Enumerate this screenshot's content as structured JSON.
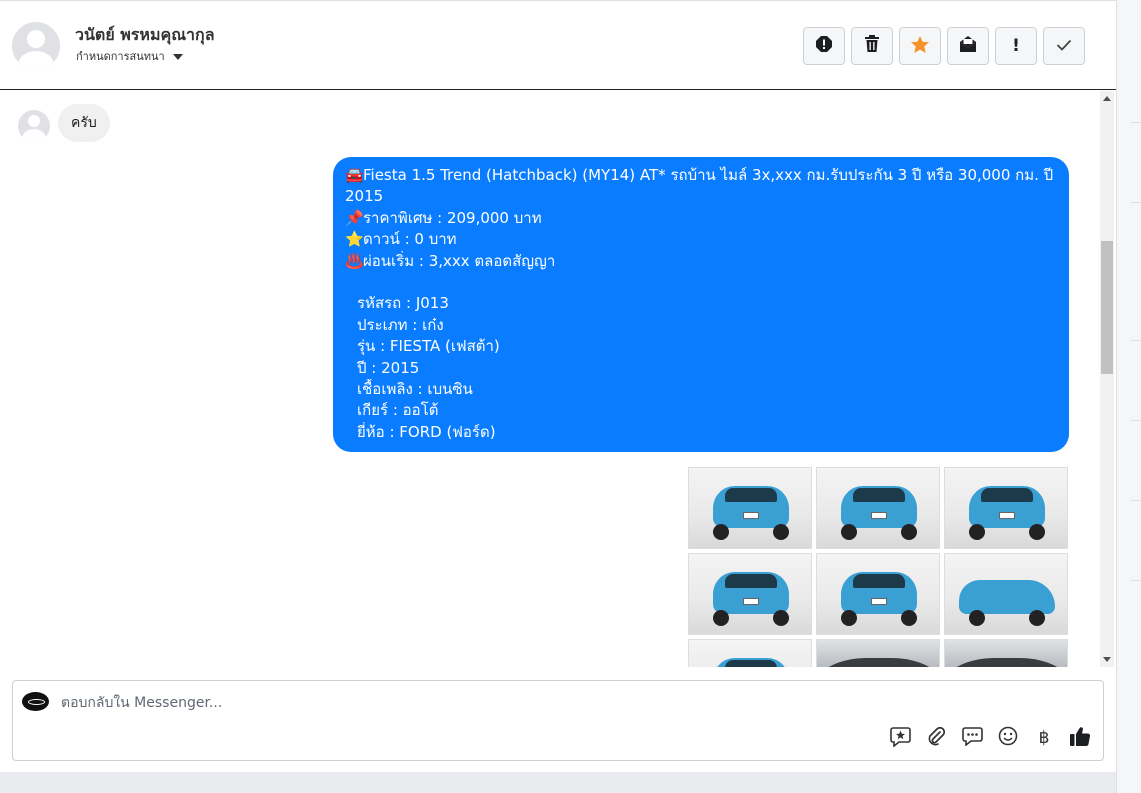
{
  "header": {
    "contact_name": "วนัตย์ พรหมคุณากุล",
    "assign_label": "กำหนดการสนทนา",
    "toolbar": [
      {
        "name": "spam-icon"
      },
      {
        "name": "trash-icon"
      },
      {
        "name": "star-icon"
      },
      {
        "name": "unread-envelope-icon"
      },
      {
        "name": "follow-up-icon",
        "glyph": "!"
      },
      {
        "name": "done-check-icon"
      }
    ]
  },
  "messages": {
    "incoming": {
      "text": "ครับ"
    },
    "outgoing": {
      "title_emoji": "🚘",
      "title": "Fiesta 1.5 Trend (Hatchback) (MY14) AT* รถบ้าน ไมล์ 3x,xxx กม.รับประกัน 3 ปี หรือ 30,000 กม. ปี",
      "title_cont": "2015",
      "price_emoji": "📌",
      "price": "ราคาพิเศษ : 209,000 บาท",
      "down_emoji": "⭐",
      "down": "ดาวน์ : 0 บาท",
      "installment_emoji": "♨️",
      "installment": "ผ่อนเริ่ม : 3,xxx ตลอดสัญญา",
      "details": [
        "รหัสรถ : J013",
        "ประเภท : เก๋ง",
        "รุ่น : FIESTA (เฟสต้า)",
        "ปี : 2015",
        "เชื้อเพลิง : เบนซิน",
        "เกียร์ : ออโต้",
        "ยี่ห้อ : FORD (ฟอร์ด)"
      ]
    },
    "photos_count": 9
  },
  "composer": {
    "placeholder": "ตอบกลับใน Messenger...",
    "baht_glyph": "฿"
  },
  "colors": {
    "outgoing_bubble": "#0a7cff",
    "incoming_bubble": "#f0f0f0",
    "star": "#f5922b"
  }
}
